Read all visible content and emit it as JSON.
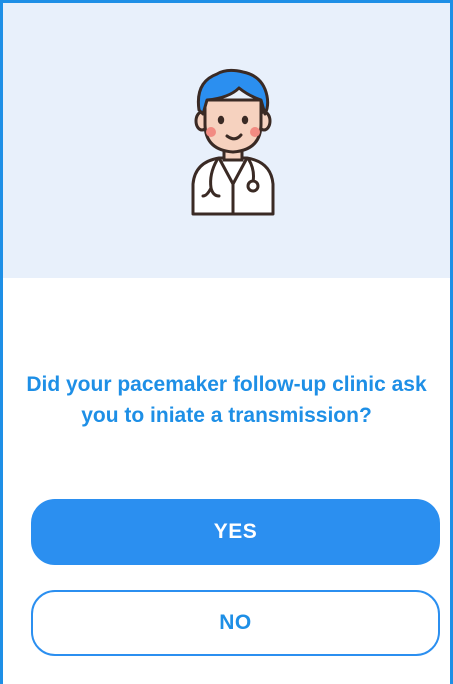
{
  "question": {
    "text": "Did your pacemaker follow-up clinic ask you to iniate a transmission?"
  },
  "buttons": {
    "yes_label": "YES",
    "no_label": "NO"
  },
  "icons": {
    "avatar": "doctor-avatar-icon"
  },
  "colors": {
    "accent": "#1e8fe6",
    "header_bg": "#e8f0fb",
    "button_fill": "#2b8ff0"
  }
}
